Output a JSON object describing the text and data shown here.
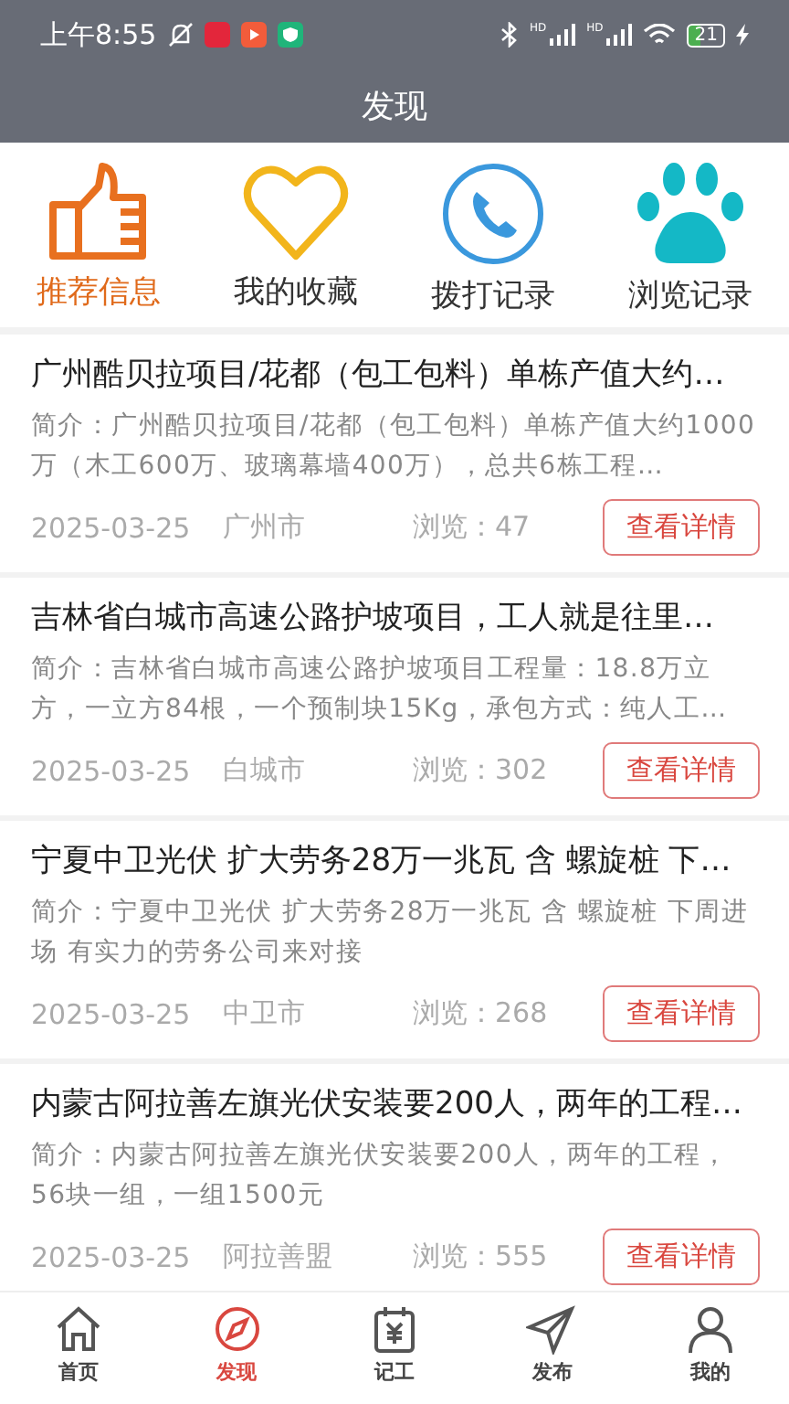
{
  "status_bar": {
    "time": "上午8:55",
    "network_labels": [
      "HD",
      "HD"
    ],
    "battery": "21"
  },
  "header": {
    "title": "发现"
  },
  "categories": [
    {
      "kind": "thumb",
      "label": "推荐信息",
      "selected": true
    },
    {
      "kind": "heart",
      "label": "我的收藏",
      "selected": false
    },
    {
      "kind": "phone",
      "label": "拨打记录",
      "selected": false
    },
    {
      "kind": "paw",
      "label": "浏览记录",
      "selected": false
    }
  ],
  "posts": [
    {
      "title": "广州酷贝拉项目/花都（包工包料）单栋产值大约…",
      "summary": "简介：广州酷贝拉项目/花都（包工包料）单栋产值大约1000万（木工600万、玻璃幕墙400万），总共6栋工程…",
      "date": "2025-03-25",
      "city": "广州市",
      "views": "浏览：47",
      "action": "查看详情"
    },
    {
      "title": "吉林省白城市高速公路护坡项目，工人就是往里…",
      "summary": "简介：吉林省白城市高速公路护坡项目工程量：18.8万立方，一立方84根，一个预制块15Kg，承包方式：纯人工…",
      "date": "2025-03-25",
      "city": "白城市",
      "views": "浏览：302",
      "action": "查看详情"
    },
    {
      "title": "宁夏中卫光伏 扩大劳务28万一兆瓦 含 螺旋桩 下…",
      "summary": "简介：宁夏中卫光伏 扩大劳务28万一兆瓦 含 螺旋桩 下周进场 有实力的劳务公司来对接",
      "date": "2025-03-25",
      "city": "中卫市",
      "views": "浏览：268",
      "action": "查看详情"
    },
    {
      "title": "内蒙古阿拉善左旗光伏安装要200人，两年的工程…",
      "summary": "简介：内蒙古阿拉善左旗光伏安装要200人，两年的工程，56块一组，一组1500元",
      "date": "2025-03-25",
      "city": "阿拉善盟",
      "views": "浏览：555",
      "action": "查看详情"
    }
  ],
  "tab_bar": [
    {
      "kind": "home",
      "label": "首页",
      "selected": false
    },
    {
      "kind": "compass",
      "label": "发现",
      "selected": true
    },
    {
      "kind": "calendar",
      "label": "记工",
      "selected": false
    },
    {
      "kind": "send",
      "label": "发布",
      "selected": false
    },
    {
      "kind": "user",
      "label": "我的",
      "selected": false
    }
  ]
}
